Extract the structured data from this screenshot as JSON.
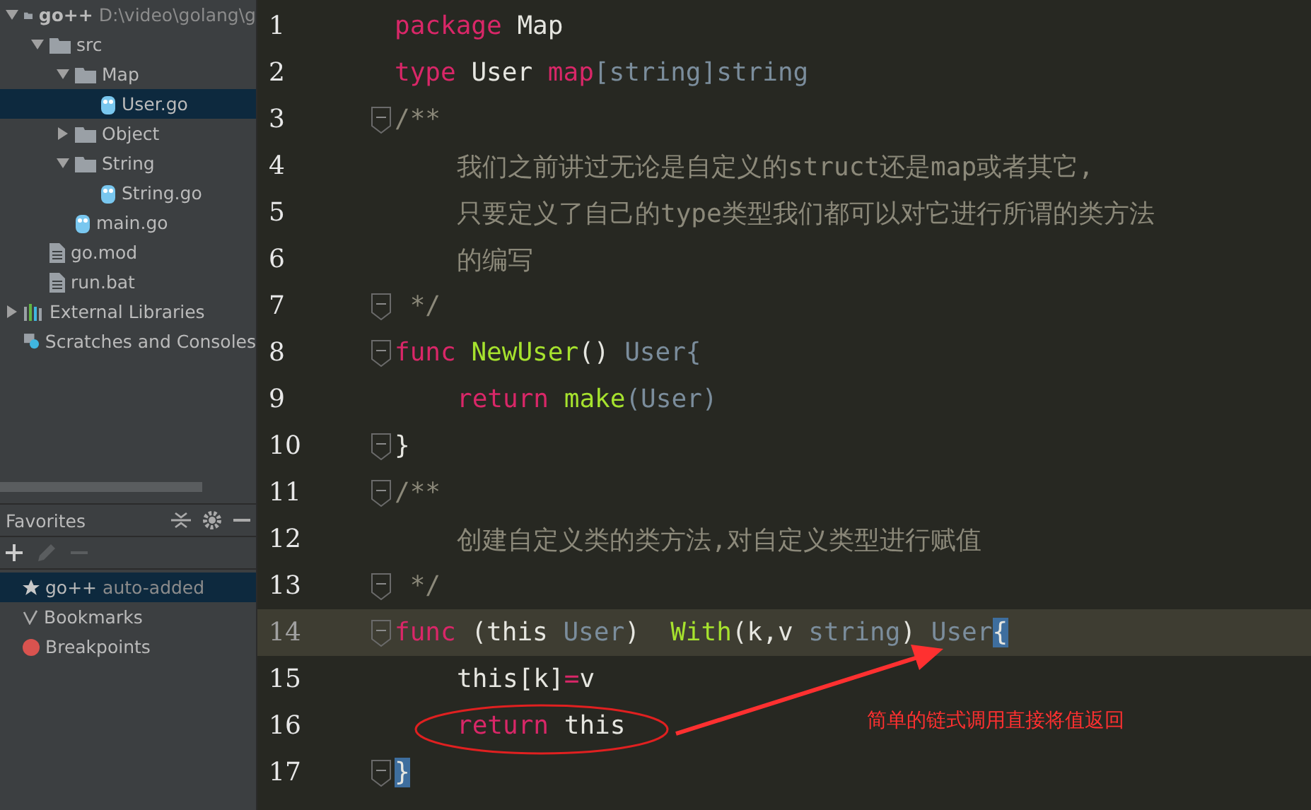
{
  "project_tree": [
    {
      "label": "go++",
      "path": "D:\\video\\golang\\g",
      "kind": "project",
      "expanded": true,
      "selected": false,
      "children": [
        {
          "label": "src",
          "kind": "folder",
          "expanded": true,
          "selected": false,
          "children": [
            {
              "label": "Map",
              "kind": "folder",
              "expanded": true,
              "selected": false,
              "children": [
                {
                  "label": "User.go",
                  "kind": "go",
                  "selected": true
                }
              ]
            },
            {
              "label": "Object",
              "kind": "folder",
              "expanded": false,
              "selected": false
            },
            {
              "label": "String",
              "kind": "folder",
              "expanded": true,
              "selected": false,
              "children": [
                {
                  "label": "String.go",
                  "kind": "go",
                  "selected": false
                }
              ]
            },
            {
              "label": "main.go",
              "kind": "go",
              "selected": false
            }
          ]
        },
        {
          "label": "go.mod",
          "kind": "text",
          "selected": false
        },
        {
          "label": "run.bat",
          "kind": "text",
          "selected": false
        }
      ]
    },
    {
      "label": "External Libraries",
      "kind": "libraries",
      "expanded": false,
      "selected": false
    },
    {
      "label": "Scratches and Consoles",
      "kind": "scratches",
      "selected": false
    }
  ],
  "favorites": {
    "title": "Favorites",
    "items": [
      {
        "label": "go++",
        "note": "auto-added",
        "kind": "star",
        "selected": true
      },
      {
        "label": "Bookmarks",
        "kind": "check",
        "selected": false
      },
      {
        "label": "Breakpoints",
        "kind": "dot",
        "color": "#d9534f",
        "selected": false
      }
    ]
  },
  "editor": {
    "lines": [
      {
        "number": "1",
        "fold": false,
        "current": false,
        "tokens": [
          {
            "text": "package",
            "kind": "keyword"
          },
          {
            "text": " Map",
            "kind": "plain"
          }
        ]
      },
      {
        "number": "2",
        "fold": false,
        "current": false,
        "tokens": [
          {
            "text": "type",
            "kind": "keyword"
          },
          {
            "text": " User ",
            "kind": "plain"
          },
          {
            "text": "map",
            "kind": "keyword"
          },
          {
            "text": "[string]string",
            "kind": "type"
          }
        ]
      },
      {
        "number": "3",
        "fold": true,
        "current": false,
        "tokens": [
          {
            "text": "/**",
            "kind": "comment"
          }
        ]
      },
      {
        "number": "4",
        "fold": false,
        "current": false,
        "tokens": [
          {
            "text": "我们之前讲过无论是自定义的struct还是map或者其它,",
            "kind": "comment"
          }
        ],
        "indent": true
      },
      {
        "number": "5",
        "fold": false,
        "current": false,
        "tokens": [
          {
            "text": "只要定义了自己的type类型我们都可以对它进行所谓的类方法",
            "kind": "comment"
          }
        ],
        "indent": true
      },
      {
        "number": "6",
        "fold": false,
        "current": false,
        "tokens": [
          {
            "text": "的编写",
            "kind": "comment"
          }
        ],
        "indent": true
      },
      {
        "number": "7",
        "fold": true,
        "current": false,
        "tokens": [
          {
            "text": " */",
            "kind": "comment"
          }
        ]
      },
      {
        "number": "8",
        "fold": true,
        "current": false,
        "tokens": [
          {
            "text": "func",
            "kind": "keyword"
          },
          {
            "text": " NewUser",
            "kind": "function"
          },
          {
            "text": "() ",
            "kind": "plain"
          },
          {
            "text": "User{",
            "kind": "type"
          }
        ]
      },
      {
        "number": "9",
        "fold": false,
        "current": false,
        "indent": true,
        "tokens": [
          {
            "text": "return",
            "kind": "keyword"
          },
          {
            "text": " make",
            "kind": "function"
          },
          {
            "text": "(User)",
            "kind": "type"
          }
        ]
      },
      {
        "number": "10",
        "fold": true,
        "current": false,
        "tokens": [
          {
            "text": "}",
            "kind": "plain"
          }
        ]
      },
      {
        "number": "11",
        "fold": true,
        "current": false,
        "tokens": [
          {
            "text": "/**",
            "kind": "comment"
          }
        ]
      },
      {
        "number": "12",
        "fold": false,
        "current": false,
        "tokens": [
          {
            "text": "创建自定义类的类方法,对自定义类型进行赋值",
            "kind": "comment"
          }
        ],
        "indent": true
      },
      {
        "number": "13",
        "fold": true,
        "current": false,
        "tokens": [
          {
            "text": " */",
            "kind": "comment"
          }
        ]
      },
      {
        "number": "14",
        "fold": true,
        "current": true,
        "tokens": [
          {
            "text": "func",
            "kind": "keyword"
          },
          {
            "text": " (this ",
            "kind": "plain"
          },
          {
            "text": "User",
            "kind": "type"
          },
          {
            "text": ")  ",
            "kind": "plain"
          },
          {
            "text": "With",
            "kind": "function"
          },
          {
            "text": "(k,v ",
            "kind": "plain"
          },
          {
            "text": "string",
            "kind": "type"
          },
          {
            "text": ") ",
            "kind": "plain"
          },
          {
            "text": "User",
            "kind": "type"
          },
          {
            "text": "{",
            "kind": "brace"
          }
        ]
      },
      {
        "number": "15",
        "fold": false,
        "current": false,
        "indent": true,
        "tokens": [
          {
            "text": "this[k]",
            "kind": "plain"
          },
          {
            "text": "=",
            "kind": "keyword"
          },
          {
            "text": "v",
            "kind": "plain"
          }
        ]
      },
      {
        "number": "16",
        "fold": false,
        "current": false,
        "indent": true,
        "tokens": [
          {
            "text": "return",
            "kind": "keyword"
          },
          {
            "text": " this",
            "kind": "plain"
          }
        ]
      },
      {
        "number": "17",
        "fold": true,
        "current": false,
        "tokens": [
          {
            "text": "}",
            "kind": "brace"
          }
        ]
      }
    ],
    "annotation": {
      "text": "简单的链式调用直接将值返回"
    }
  }
}
